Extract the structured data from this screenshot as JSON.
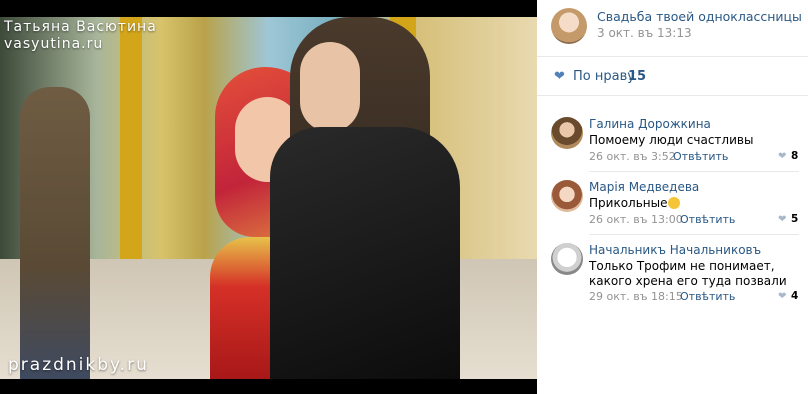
{
  "photo": {
    "watermark_name": "Татьяна Васютина",
    "watermark_site": "vasyutina.ru",
    "watermark_bottom": "prazdnikby.ru"
  },
  "post": {
    "title": "Свадьба твоей одноклассницы",
    "date": "3 окт. въ 13:13",
    "like_label": "По нраву",
    "like_count": "15"
  },
  "comments": [
    {
      "author": "Галина Дорожкина",
      "text": "Помоему люди счастливы",
      "date": "26 окт. въ 3:52",
      "reply": "Отвѣтить",
      "likes": "8"
    },
    {
      "author": "Марія Медведева",
      "text": "Прикольные",
      "date": "26 окт. въ 13:00",
      "reply": "Отвѣтить",
      "likes": "5"
    },
    {
      "author": "Начальникъ Начальниковъ",
      "text": "Только Трофим не понимает, какого хрена его туда позвали",
      "date": "29 окт. въ 18:15",
      "reply": "Отвѣтить",
      "likes": "4"
    }
  ]
}
